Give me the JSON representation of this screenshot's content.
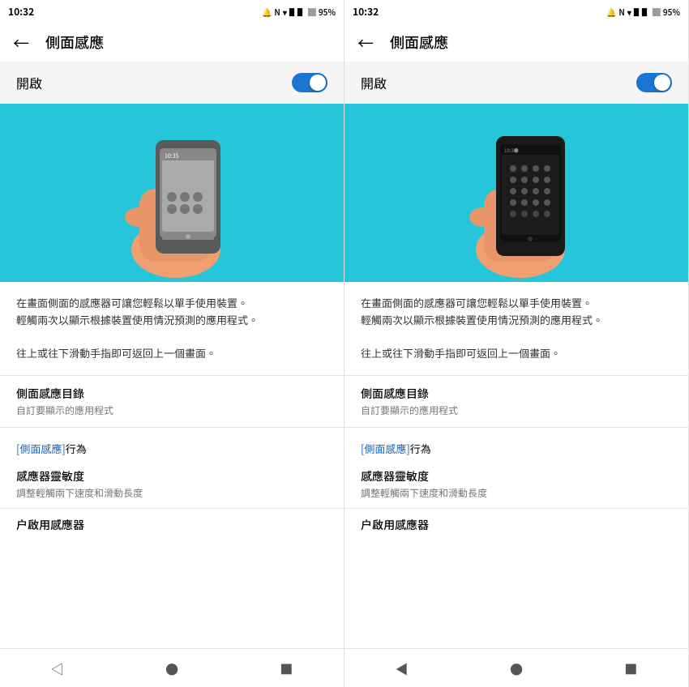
{
  "panels": [
    {
      "id": "left",
      "statusBar": {
        "time": "10:32",
        "battery": "95%"
      },
      "topBar": {
        "backLabel": "←",
        "title": "側面感應"
      },
      "toggleRow": {
        "label": "開啟",
        "isOn": true
      },
      "illustration": {
        "type": "light"
      },
      "description": {
        "line1": "在畫面側面的感應器可讓您輕鬆以單手使用裝置。",
        "line2": "輕觸兩次以顯示根據裝置使用情況預測的應用程式。",
        "line3": "",
        "line4": "往上或往下滑動手指即可返回上一個畫面。"
      },
      "menuItem": {
        "title": "側面感應目錄",
        "sub": "自訂要顯示的應用程式"
      },
      "linkSection": {
        "linkPart": "[側面感應]",
        "normalPart": "行為"
      },
      "sensitivityItem": {
        "title": "感應器靈敏度",
        "sub": "調整輕觸兩下速度和滑動長度"
      },
      "enableItem": {
        "title": "户啟用感應器"
      },
      "nav": {
        "back": "◁",
        "home": "●",
        "recent": "■"
      }
    },
    {
      "id": "right",
      "statusBar": {
        "time": "10:32",
        "battery": "95%"
      },
      "topBar": {
        "backLabel": "←",
        "title": "側面感應"
      },
      "toggleRow": {
        "label": "開啟",
        "isOn": true
      },
      "illustration": {
        "type": "dark"
      },
      "description": {
        "line1": "在畫面側面的感應器可讓您輕鬆以單手使用裝置。",
        "line2": "輕觸兩次以顯示根據裝置使用情況預測的應用程式。",
        "line3": "",
        "line4": "往上或往下滑動手指即可返回上一個畫面。"
      },
      "menuItem": {
        "title": "側面感應目錄",
        "sub": "自訂要顯示的應用程式"
      },
      "linkSection": {
        "linkPart": "[側面感應]",
        "normalPart": "行為"
      },
      "sensitivityItem": {
        "title": "感應器靈敏度",
        "sub": "調整輕觸兩下速度和滑動長度"
      },
      "enableItem": {
        "title": "户啟用感應器"
      },
      "nav": {
        "back": "◀",
        "home": "●",
        "recent": "■"
      }
    }
  ]
}
